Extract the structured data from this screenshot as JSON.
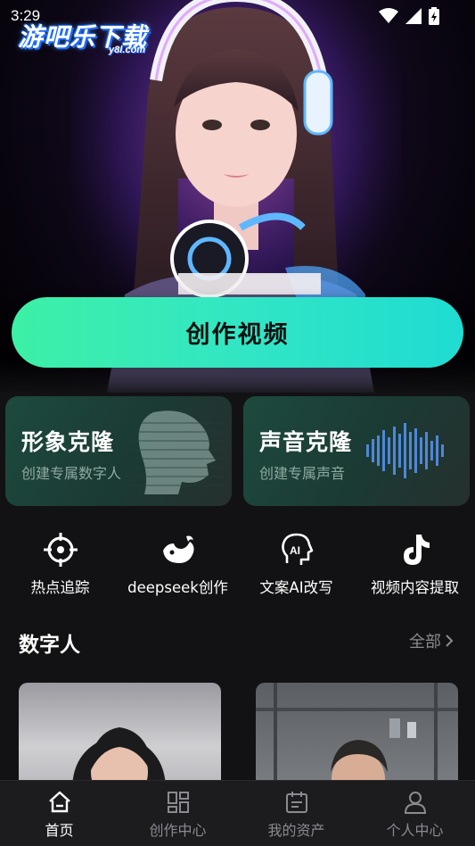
{
  "status_bar": {
    "time": "3:29"
  },
  "watermark": {
    "main": "游吧乐下载",
    "sub": "y8l.com"
  },
  "hero": {
    "create_button_label": "创作视频"
  },
  "cards": [
    {
      "title": "形象克隆",
      "subtitle": "创建专属数字人"
    },
    {
      "title": "声音克隆",
      "subtitle": "创建专属声音"
    }
  ],
  "quick_actions": [
    {
      "label": "热点追踪",
      "icon": "crosshair-icon"
    },
    {
      "label": "deepseek创作",
      "icon": "deepseek-whale-icon"
    },
    {
      "label": "文案AI改写",
      "icon": "ai-head-icon"
    },
    {
      "label": "视频内容提取",
      "icon": "tiktok-icon"
    }
  ],
  "section": {
    "title": "数字人",
    "more_label": "全部"
  },
  "tabs": [
    {
      "label": "首页",
      "icon": "home-icon",
      "active": true
    },
    {
      "label": "创作中心",
      "icon": "grid-icon",
      "active": false
    },
    {
      "label": "我的资产",
      "icon": "calendar-icon",
      "active": false
    },
    {
      "label": "个人中心",
      "icon": "user-icon",
      "active": false
    }
  ],
  "colors": {
    "accent_gradient_start": "#3df0a6",
    "accent_gradient_end": "#1fdcd2",
    "background": "#121214",
    "card_background": "#1b3a34"
  }
}
